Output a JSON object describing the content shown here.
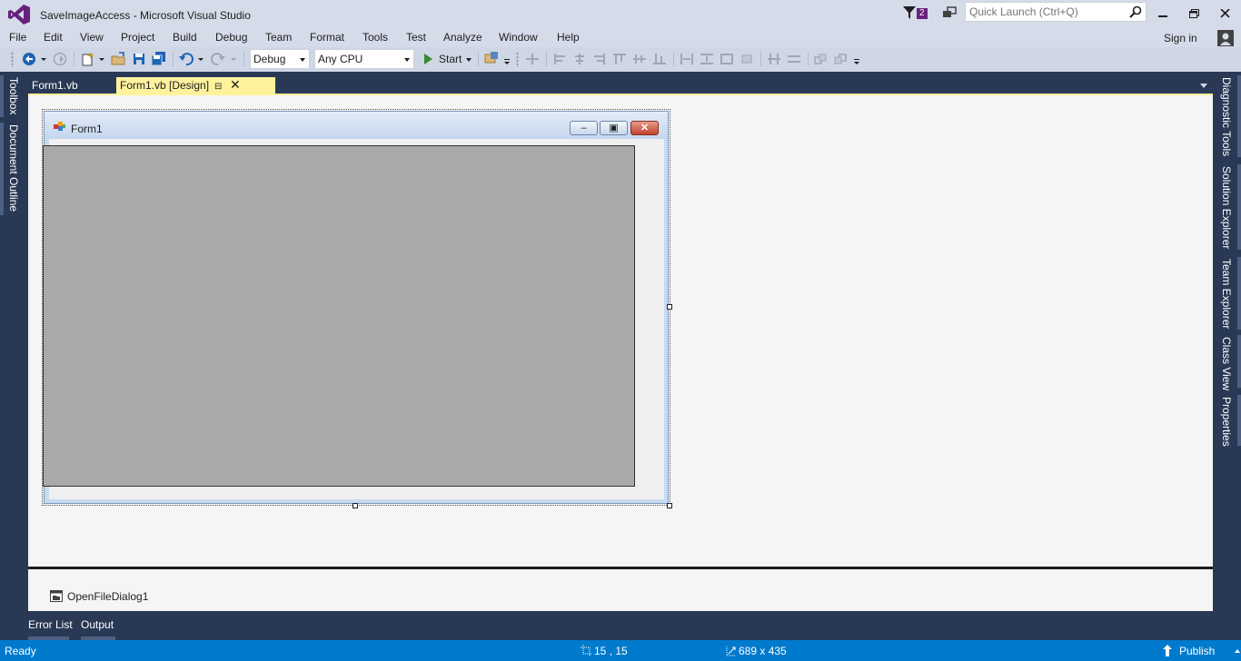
{
  "window": {
    "title": "SaveImageAccess - Microsoft Visual Studio",
    "notification_count": "2",
    "quick_launch_placeholder": "Quick Launch (Ctrl+Q)"
  },
  "menu": {
    "items": [
      "File",
      "Edit",
      "View",
      "Project",
      "Build",
      "Debug",
      "Team",
      "Format",
      "Tools",
      "Test",
      "Analyze",
      "Window",
      "Help"
    ],
    "sign_in": "Sign in"
  },
  "toolbar": {
    "configuration": "Debug",
    "platform": "Any CPU",
    "start_label": "Start"
  },
  "left_tool_windows": [
    "Toolbox",
    "Document Outline"
  ],
  "right_tool_windows": [
    "Diagnostic Tools",
    "Solution Explorer",
    "Team Explorer",
    "Class View",
    "Properties"
  ],
  "document_tabs": [
    {
      "label": "Form1.vb",
      "active": false
    },
    {
      "label": "Form1.vb [Design]",
      "active": true
    }
  ],
  "designer": {
    "form_title": "Form1",
    "tray_components": [
      "OpenFileDialog1"
    ]
  },
  "bottom_tool_windows": [
    "Error List",
    "Output"
  ],
  "status": {
    "text": "Ready",
    "position": "15 , 15",
    "size": "689 x 435",
    "publish": "Publish"
  },
  "colors": {
    "vs_purple": "#68217a",
    "chrome": "#d6dbe9",
    "dark_frame": "#293955",
    "status_blue": "#007acc",
    "active_tab": "#fff29d",
    "picturebox": "#a9a9a9"
  }
}
